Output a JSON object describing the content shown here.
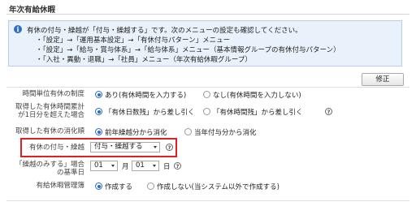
{
  "page": {
    "title": "年次有給休暇"
  },
  "info": {
    "lines": [
      "有休の付与・繰越が「付与・繰越する」です。次のメニューの設定も確認してください。",
      "・「設定」→「運用基本設定」→「有休付与パターン」メニュー",
      "・「設定」→「給与・賞与体系」→「給与体系」メニュー（基本情報グループの有休付与パターン）",
      "・「入社・異動・退職」→「社員」メニュー（年次有給休暇グループ）"
    ]
  },
  "toolbar": {
    "edit_label": "修正"
  },
  "settings": {
    "hourly": {
      "label": "時間単位有休の制度",
      "options": [
        "あり(有休時間を入力する)",
        "なし(有休時間を入力しない)"
      ],
      "selected": 0
    },
    "over_day": {
      "label_line1": "取得した有休時間累計",
      "label_line2": "が1日分を超えた場合",
      "options": [
        "「有休日数残」から差し引く",
        "「有休時間残」から差し引く"
      ],
      "selected": 0
    },
    "consume_order": {
      "label": "取得した有休の消化順",
      "options": [
        "前年繰越分から消化",
        "当年付与分から消化"
      ],
      "selected": 0
    },
    "grant_carry": {
      "label": "有休の付与・繰越",
      "value": "付与・繰越する"
    },
    "carry_base": {
      "label_line1": "「繰越のみする」場合",
      "label_line2": "の基準日",
      "month": "01",
      "month_unit": "月",
      "day": "01",
      "day_unit": "日"
    },
    "leave_register": {
      "label": "有給休暇管理簿",
      "options": [
        "作成する",
        "作成しない(当システム以外で作成する)"
      ],
      "selected": 0
    }
  },
  "icons": {
    "info": "info-icon",
    "help": "question-circle-icon",
    "dropdown": "chevron-down-icon"
  },
  "colors": {
    "accent": "#2c69c9",
    "highlight": "#e02020",
    "info_bg": "#e9f2fb"
  }
}
